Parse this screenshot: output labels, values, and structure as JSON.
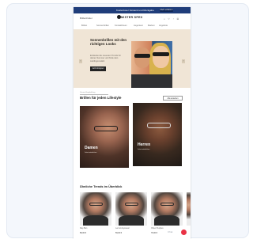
{
  "topbar": {
    "text": "Kostenloser Versand und Rückgabe",
    "cta": "Mehr erfahren"
  },
  "header": {
    "link": "Brillenfinder",
    "logo": "MISTER SPEX",
    "icons": [
      "search-icon",
      "heart-icon",
      "user-icon",
      "cart-icon"
    ]
  },
  "nav": {
    "items": [
      "Brillen",
      "Sonnenbrillen",
      "Kontaktlinsen",
      "Augentest",
      "Marken",
      "Angebote"
    ]
  },
  "hero": {
    "title": "Sonnenbrillen mit den richtigen Looks",
    "text": "Entdecke die neuesten Trends für deinen Sommer und finde dein Lieblingsmodell.",
    "button": "Jetzt shoppen",
    "prev_label": "‹",
    "next_label": "›"
  },
  "section": {
    "eyebrow": "Unsere Empfehlung",
    "title": "Brillen für jeden Lifestyle",
    "button": "Alle ansehen",
    "tiles": [
      {
        "caption": "Damen",
        "sub": "Jetzt entdecken"
      },
      {
        "caption": "Herren",
        "sub": "Jetzt entdecken"
      }
    ]
  },
  "similar": {
    "title": "Ähnliche Trends im Überblick",
    "products": [
      {
        "name": "Ray-Ban",
        "price": "89,00 €"
      },
      {
        "name": "Lennox Eyewear",
        "price": "59,00 €"
      },
      {
        "name": "Oliver Peoples",
        "price": "79,00 €"
      }
    ]
  },
  "chat": {
    "label": "Chat"
  },
  "colors": {
    "topbar": "#1f3d7a",
    "hero_bg": "#f0e5d6",
    "chat_button": "#e93245"
  }
}
